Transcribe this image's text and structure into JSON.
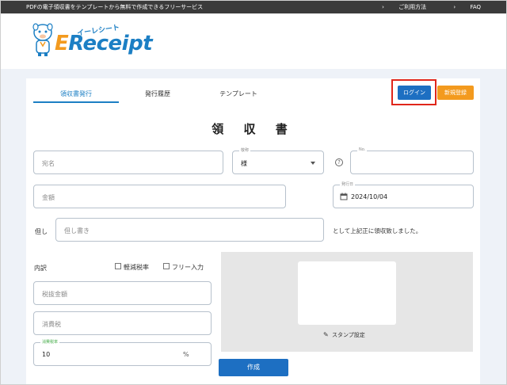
{
  "topbar": {
    "tagline": "PDFの電子領収書をテンプレートから無料で作成できるフリーサービス",
    "links": [
      "ご利用方法",
      "FAQ"
    ]
  },
  "logo": {
    "kana": "イーレシート",
    "text_e": "E",
    "text_rest": "Receipt"
  },
  "tabs": [
    {
      "label": "領収書発行",
      "active": true
    },
    {
      "label": "発行履歴",
      "active": false
    },
    {
      "label": "テンプレート",
      "active": false
    }
  ],
  "header_buttons": {
    "login": "ログイン",
    "register": "新規登録"
  },
  "form": {
    "title": "領 収 書",
    "addressee_placeholder": "宛名",
    "honorific_label": "敬称",
    "honorific_value": "様",
    "number_label": "No.",
    "amount_placeholder": "金額",
    "issue_date_label": "発行日",
    "issue_date_value": "2024/10/04",
    "proviso_label": "但し",
    "proviso_placeholder": "但し書き",
    "received_text": "として上記正に領収致しました。",
    "breakdown_label": "内訳",
    "reduced_tax_label": "軽減税率",
    "free_input_label": "フリー入力",
    "pre_tax_placeholder": "税抜金額",
    "consumption_tax_placeholder": "消費税",
    "tax_rate_label": "消費税率",
    "tax_rate_value": "10",
    "tax_rate_unit": "%",
    "stamp_setting_label": "スタンプ設定",
    "create_button": "作成"
  },
  "icons": {
    "help": "question-circle-icon",
    "calendar": "calendar-icon",
    "pencil": "pencil-icon",
    "chevron": "chevron-right-icon"
  },
  "colors": {
    "accent": "#1c7fc4",
    "primary_button": "#1d6fc2",
    "orange": "#f39a1e",
    "highlight": "#e0261b"
  }
}
